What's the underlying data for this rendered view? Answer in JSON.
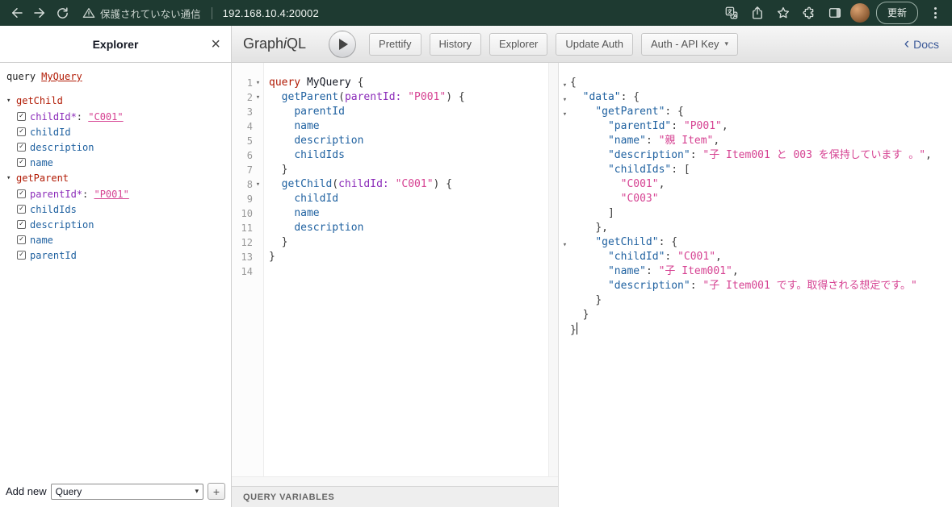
{
  "browser": {
    "security_warning": "保護されていない通信",
    "url": "192.168.10.4:20002",
    "update_button_label": "更新"
  },
  "graphiql": {
    "logo": {
      "part1": "Graph",
      "part2": "i",
      "part3": "QL"
    },
    "toolbar_buttons": [
      "Prettify",
      "History",
      "Explorer",
      "Update Auth"
    ],
    "auth_dropdown_label": "Auth - API Key",
    "docs_link_label": "Docs"
  },
  "explorer_panel": {
    "title": "Explorer",
    "query_keyword": "query",
    "operation_name": "MyQuery",
    "tree": [
      {
        "name": "getChild",
        "children": [
          {
            "kind": "arg",
            "name": "childId*",
            "value": "\"C001\"",
            "checked": true
          },
          {
            "kind": "field",
            "name": "childId",
            "checked": true
          },
          {
            "kind": "field",
            "name": "description",
            "checked": true
          },
          {
            "kind": "field",
            "name": "name",
            "checked": true
          }
        ]
      },
      {
        "name": "getParent",
        "children": [
          {
            "kind": "arg",
            "name": "parentId*",
            "value": "\"P001\"",
            "checked": true
          },
          {
            "kind": "field",
            "name": "childIds",
            "checked": true
          },
          {
            "kind": "field",
            "name": "description",
            "checked": true
          },
          {
            "kind": "field",
            "name": "name",
            "checked": true
          },
          {
            "kind": "field",
            "name": "parentId",
            "checked": true
          }
        ]
      }
    ],
    "footer": {
      "add_new_label": "Add new",
      "type_select_value": "Query",
      "add_button_label": "+"
    }
  },
  "editor": {
    "variables_section_title": "QUERY VARIABLES",
    "lines": [
      {
        "num": 1,
        "fold": true,
        "tokens": [
          {
            "c": "k",
            "t": "query"
          },
          {
            "c": "t",
            "t": " MyQuery "
          },
          {
            "c": "u",
            "t": "{"
          }
        ]
      },
      {
        "num": 2,
        "fold": true,
        "tokens": [
          {
            "c": "t",
            "t": "  "
          },
          {
            "c": "p",
            "t": "getParent"
          },
          {
            "c": "u",
            "t": "("
          },
          {
            "c": "a",
            "t": "parentId:"
          },
          {
            "c": "t",
            "t": " "
          },
          {
            "c": "s",
            "t": "\"P001\""
          },
          {
            "c": "u",
            "t": ") {"
          }
        ]
      },
      {
        "num": 3,
        "tokens": [
          {
            "c": "t",
            "t": "    "
          },
          {
            "c": "p",
            "t": "parentId"
          }
        ]
      },
      {
        "num": 4,
        "tokens": [
          {
            "c": "t",
            "t": "    "
          },
          {
            "c": "p",
            "t": "name"
          }
        ]
      },
      {
        "num": 5,
        "tokens": [
          {
            "c": "t",
            "t": "    "
          },
          {
            "c": "p",
            "t": "description"
          }
        ]
      },
      {
        "num": 6,
        "tokens": [
          {
            "c": "t",
            "t": "    "
          },
          {
            "c": "p",
            "t": "childIds"
          }
        ]
      },
      {
        "num": 7,
        "tokens": [
          {
            "c": "t",
            "t": "  "
          },
          {
            "c": "u",
            "t": "}"
          }
        ]
      },
      {
        "num": 8,
        "fold": true,
        "tokens": [
          {
            "c": "t",
            "t": "  "
          },
          {
            "c": "p",
            "t": "getChild"
          },
          {
            "c": "u",
            "t": "("
          },
          {
            "c": "a",
            "t": "childId:"
          },
          {
            "c": "t",
            "t": " "
          },
          {
            "c": "s",
            "t": "\"C001\""
          },
          {
            "c": "u",
            "t": ") {"
          }
        ]
      },
      {
        "num": 9,
        "tokens": [
          {
            "c": "t",
            "t": "    "
          },
          {
            "c": "p",
            "t": "childId"
          }
        ]
      },
      {
        "num": 10,
        "tokens": [
          {
            "c": "t",
            "t": "    "
          },
          {
            "c": "p",
            "t": "name"
          }
        ]
      },
      {
        "num": 11,
        "tokens": [
          {
            "c": "t",
            "t": "    "
          },
          {
            "c": "p",
            "t": "description"
          }
        ]
      },
      {
        "num": 12,
        "tokens": [
          {
            "c": "t",
            "t": "  "
          },
          {
            "c": "u",
            "t": "}"
          }
        ]
      },
      {
        "num": 13,
        "tokens": [
          {
            "c": "u",
            "t": "}"
          }
        ]
      },
      {
        "num": 14,
        "tokens": []
      }
    ]
  },
  "result": {
    "lines": [
      {
        "fold": true,
        "tokens": [
          {
            "c": "u",
            "t": "{"
          }
        ]
      },
      {
        "fold": true,
        "tokens": [
          {
            "c": "t",
            "t": "  "
          },
          {
            "c": "y",
            "t": "\"data\""
          },
          {
            "c": "u",
            "t": ": {"
          }
        ]
      },
      {
        "fold": true,
        "tokens": [
          {
            "c": "t",
            "t": "    "
          },
          {
            "c": "y",
            "t": "\"getParent\""
          },
          {
            "c": "u",
            "t": ": {"
          }
        ]
      },
      {
        "tokens": [
          {
            "c": "t",
            "t": "      "
          },
          {
            "c": "y",
            "t": "\"parentId\""
          },
          {
            "c": "u",
            "t": ": "
          },
          {
            "c": "s",
            "t": "\"P001\""
          },
          {
            "c": "u",
            "t": ","
          }
        ]
      },
      {
        "tokens": [
          {
            "c": "t",
            "t": "      "
          },
          {
            "c": "y",
            "t": "\"name\""
          },
          {
            "c": "u",
            "t": ": "
          },
          {
            "c": "s",
            "t": "\"親 Item\""
          },
          {
            "c": "u",
            "t": ","
          }
        ]
      },
      {
        "tokens": [
          {
            "c": "t",
            "t": "      "
          },
          {
            "c": "y",
            "t": "\"description\""
          },
          {
            "c": "u",
            "t": ": "
          },
          {
            "c": "s",
            "t": "\"子 Item001 と 003 を保持しています 。\""
          },
          {
            "c": "u",
            "t": ","
          }
        ]
      },
      {
        "tokens": [
          {
            "c": "t",
            "t": "      "
          },
          {
            "c": "y",
            "t": "\"childIds\""
          },
          {
            "c": "u",
            "t": ": ["
          }
        ]
      },
      {
        "tokens": [
          {
            "c": "t",
            "t": "        "
          },
          {
            "c": "s",
            "t": "\"C001\""
          },
          {
            "c": "u",
            "t": ","
          }
        ]
      },
      {
        "tokens": [
          {
            "c": "t",
            "t": "        "
          },
          {
            "c": "s",
            "t": "\"C003\""
          }
        ]
      },
      {
        "tokens": [
          {
            "c": "t",
            "t": "      "
          },
          {
            "c": "u",
            "t": "]"
          }
        ]
      },
      {
        "tokens": [
          {
            "c": "t",
            "t": "    "
          },
          {
            "c": "u",
            "t": "},"
          }
        ]
      },
      {
        "fold": true,
        "tokens": [
          {
            "c": "t",
            "t": "    "
          },
          {
            "c": "y",
            "t": "\"getChild\""
          },
          {
            "c": "u",
            "t": ": {"
          }
        ]
      },
      {
        "tokens": [
          {
            "c": "t",
            "t": "      "
          },
          {
            "c": "y",
            "t": "\"childId\""
          },
          {
            "c": "u",
            "t": ": "
          },
          {
            "c": "s",
            "t": "\"C001\""
          },
          {
            "c": "u",
            "t": ","
          }
        ]
      },
      {
        "tokens": [
          {
            "c": "t",
            "t": "      "
          },
          {
            "c": "y",
            "t": "\"name\""
          },
          {
            "c": "u",
            "t": ": "
          },
          {
            "c": "s",
            "t": "\"子 Item001\""
          },
          {
            "c": "u",
            "t": ","
          }
        ]
      },
      {
        "tokens": [
          {
            "c": "t",
            "t": "      "
          },
          {
            "c": "y",
            "t": "\"description\""
          },
          {
            "c": "u",
            "t": ": "
          },
          {
            "c": "s",
            "t": "\"子 Item001 です。取得される想定です。\""
          }
        ]
      },
      {
        "tokens": [
          {
            "c": "t",
            "t": "    "
          },
          {
            "c": "u",
            "t": "}"
          }
        ]
      },
      {
        "tokens": [
          {
            "c": "t",
            "t": "  "
          },
          {
            "c": "u",
            "t": "}"
          }
        ]
      },
      {
        "cursor": true,
        "tokens": [
          {
            "c": "u",
            "t": "}"
          }
        ]
      }
    ]
  },
  "colors": {
    "chrome-bar": "#1e3a31",
    "red": "#B11A04",
    "blue": "#1F61A0",
    "purple": "#8B2BB9",
    "pink": "#D64292",
    "punct": "#393939",
    "docs": "#3B5998"
  }
}
